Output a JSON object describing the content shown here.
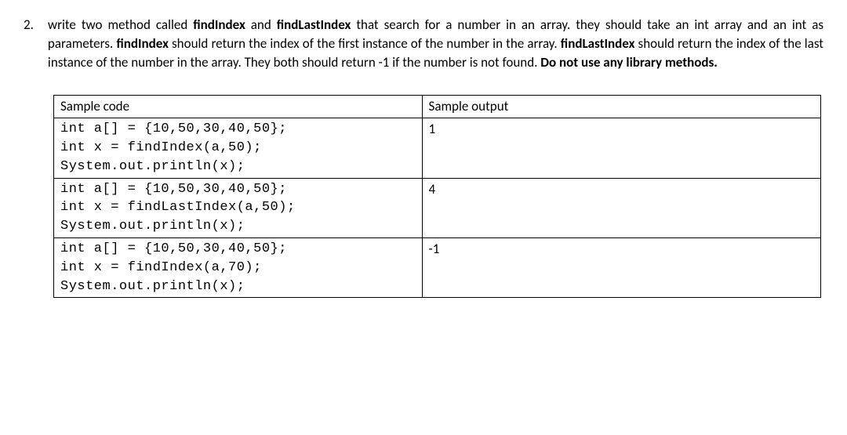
{
  "question": {
    "number": "2.",
    "text_parts": {
      "p1": "write two method called ",
      "b1": "findIndex",
      "p2": " and ",
      "b2": "findLastIndex",
      "p3": " that search for a number in an array. they should take an int array and an int as parameters. ",
      "b3": "findIndex",
      "p4": " should return the index of the first instance of the number in the array.  ",
      "b4": "findLastIndex",
      "p5": " should return the index of the last instance of the number in the array. They both should return -1 if the number is not found. ",
      "b5": "Do not use any library methods."
    }
  },
  "table": {
    "header": {
      "left": "Sample code",
      "right": "Sample output"
    },
    "rows": [
      {
        "code": "int a[] = {10,50,30,40,50};\nint x = findIndex(a,50);\nSystem.out.println(x);",
        "output": "1"
      },
      {
        "code": "int a[] = {10,50,30,40,50};\nint x = findLastIndex(a,50);\nSystem.out.println(x);",
        "output": "4"
      },
      {
        "code": "int a[] = {10,50,30,40,50};\nint x = findIndex(a,70);\nSystem.out.println(x);",
        "output": "-1"
      }
    ]
  }
}
